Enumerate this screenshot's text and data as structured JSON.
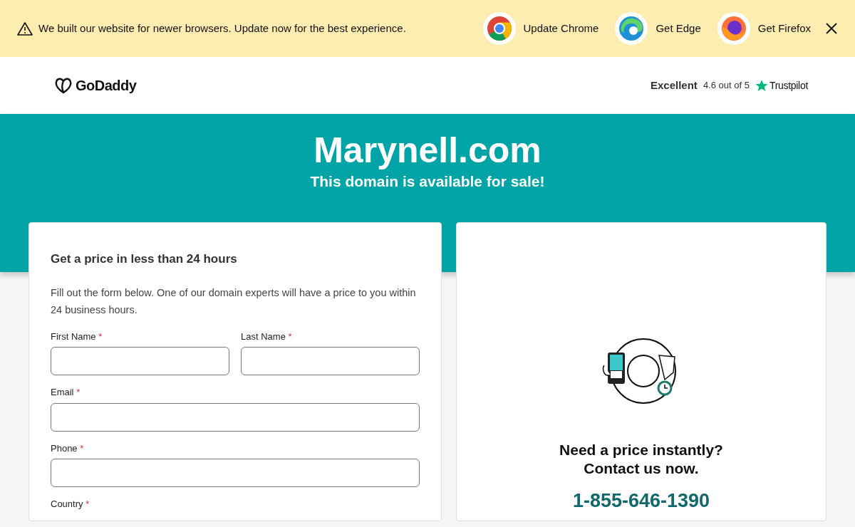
{
  "banner": {
    "message": "We built our website for newer browsers. Update now for the best experience.",
    "browsers": [
      {
        "kind": "chrome",
        "label": "Update Chrome"
      },
      {
        "kind": "edge",
        "label": "Get Edge"
      },
      {
        "kind": "firefox",
        "label": "Get Firefox"
      }
    ]
  },
  "header": {
    "logo": "GoDaddy",
    "rating_word": "Excellent",
    "rating": "4.6 out of 5",
    "review_site": "Trustpilot"
  },
  "hero": {
    "domain": "Marynell.com",
    "subtitle": "This domain is available for sale!"
  },
  "form": {
    "title": "Get a price in less than 24 hours",
    "description": "Fill out the form below. One of our domain experts will have a price to you within 24 business hours.",
    "fields": [
      {
        "label": "First Name",
        "mark": "*",
        "kind": "half"
      },
      {
        "label": "Last Name",
        "mark": "*",
        "kind": "half"
      },
      {
        "label": "Email",
        "mark": "*",
        "kind": "full"
      },
      {
        "label": "Phone",
        "mark": "*",
        "kind": "full"
      },
      {
        "label": "Country",
        "mark": "*",
        "kind": "label"
      }
    ]
  },
  "contact": {
    "heading_1": "Need a price instantly?",
    "heading_2": "Contact us now.",
    "phone": "1-855-646-1390"
  }
}
